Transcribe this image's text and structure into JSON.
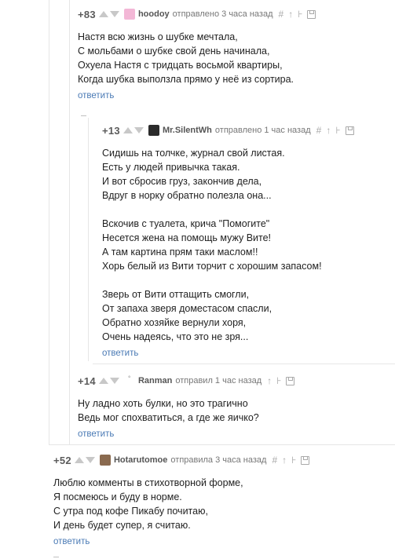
{
  "comments": [
    {
      "rating": "+83",
      "author": "hoodoy",
      "posted": "отправлено 3 часа назад",
      "avatar_color": "#f3b7d6",
      "lines": [
        "Настя всю жизнь о шубке мечтала,",
        "С мольбами о шубке свой день начинала,",
        "Охуела Настя с тридцать восьмой квартиры,",
        "Когда шубка выползла прямо у неё из сортира."
      ],
      "reply": "ответить"
    },
    {
      "rating": "+13",
      "author": "Mr.SilentWh",
      "posted": "отправлено 1 час назад",
      "avatar_color": "#2b2b2b",
      "lines": [
        "Сидишь на толчке, журнал свой листая.",
        "Есть у людей привычка такая.",
        "И вот сбросив груз, закончив дела,",
        "Вдруг в норку обратно полезла она...",
        "",
        "Вскочив с туалета, крича \"Помогите\"",
        "Несется жена на помощь мужу Вите!",
        "А там картина прям таки маслом!!",
        "Хорь белый из Вити торчит с хорошим запасом!",
        "",
        "Зверь от Вити оттащить смогли,",
        "От запаха зверя доместасом спасли,",
        "Обратно хозяйке вернули хоря,",
        "Очень надеясь, что это не зря..."
      ],
      "reply": "ответить"
    },
    {
      "rating": "+14",
      "author": "Ranman",
      "posted": "отправил 1 час назад",
      "avatar_color": "#ffffff",
      "lines": [
        "Ну ладно хоть булки, но это трагично",
        "Ведь мог спохватиться, а где же яичко?"
      ],
      "reply": "ответить"
    },
    {
      "rating": "+52",
      "author": "Hotarutomoe",
      "posted": "отправила 3 часа назад",
      "avatar_color": "#8a6a4f",
      "lines": [
        "Люблю комменты в стихотворной форме,",
        "Я посмеюсь и буду в норме.",
        "С утра под кофе Пикабу почитаю,",
        "И день будет супер, я считаю."
      ],
      "reply": "ответить"
    }
  ]
}
